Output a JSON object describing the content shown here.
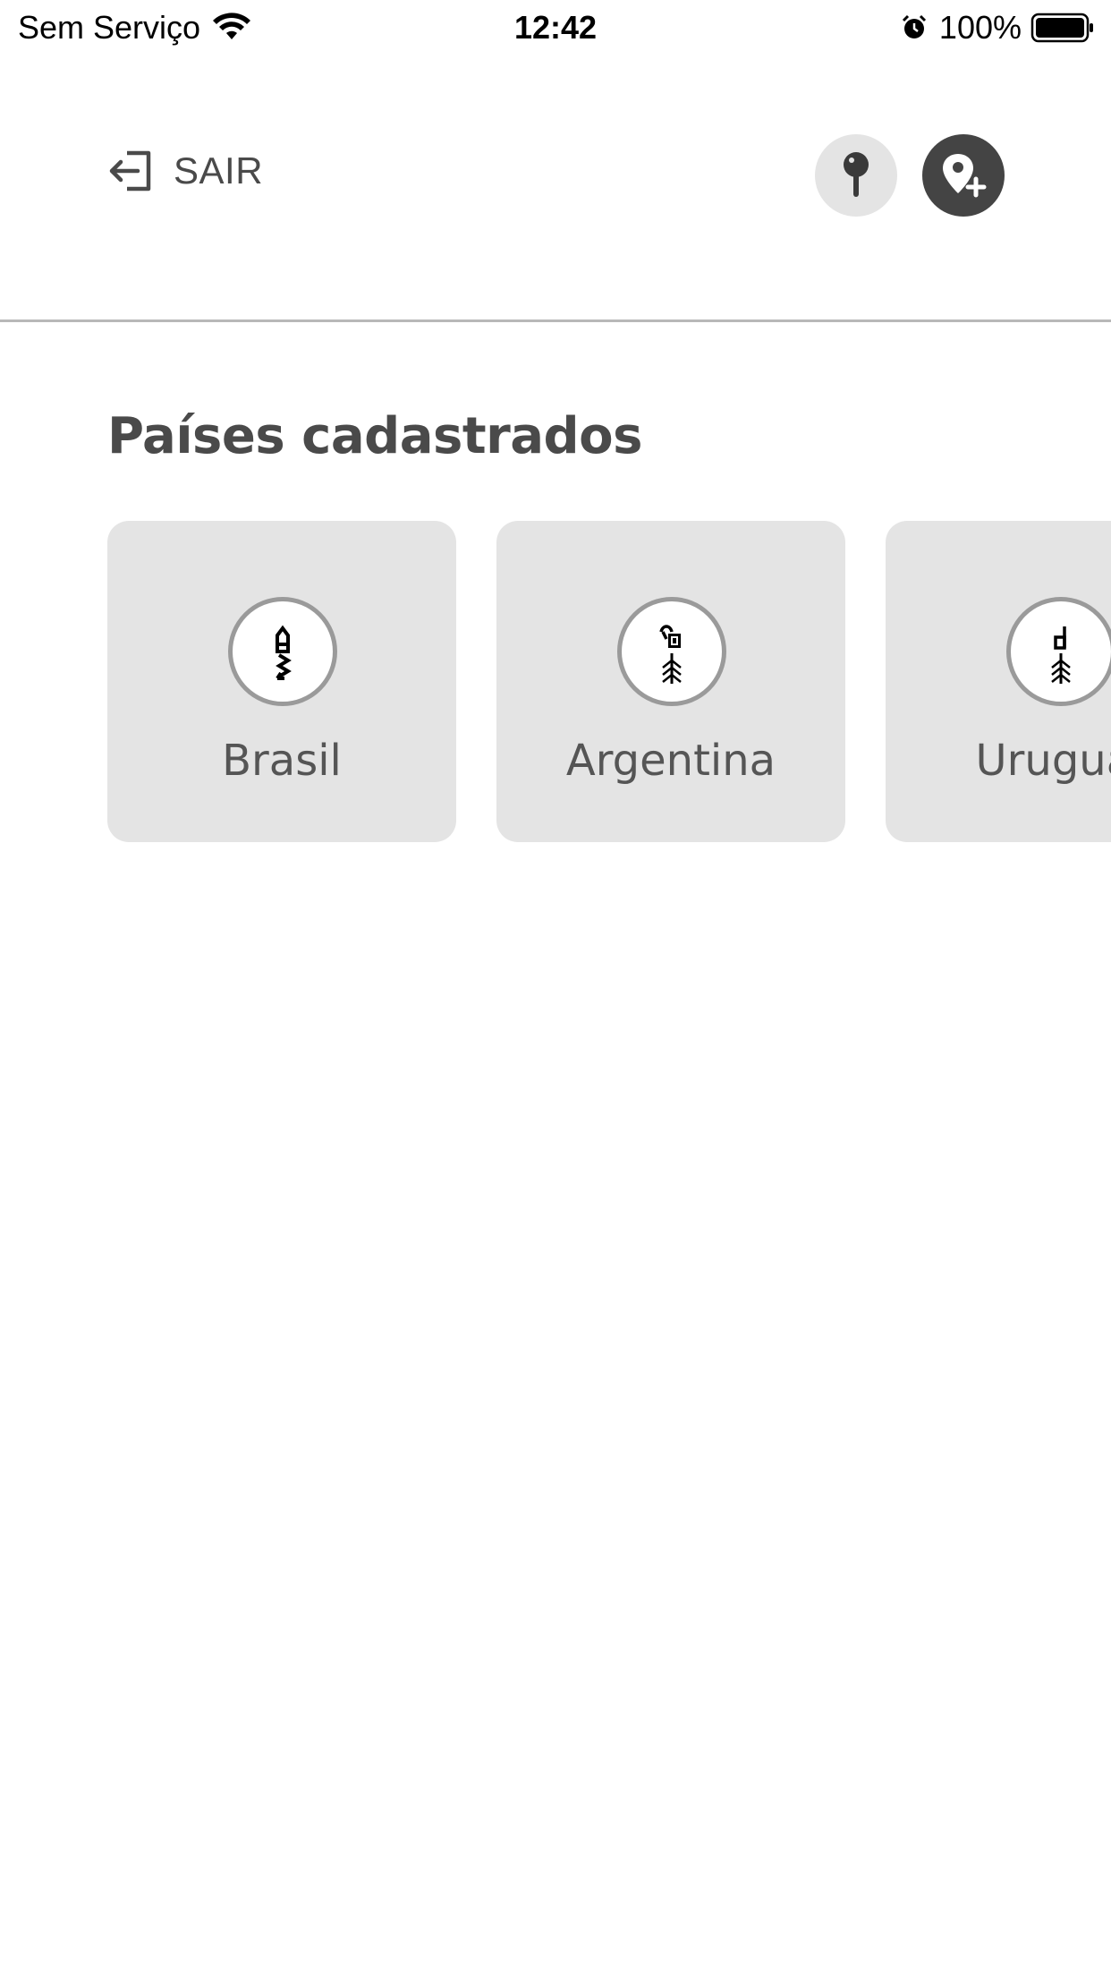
{
  "status_bar": {
    "carrier": "Sem Serviço",
    "time": "12:42",
    "battery": "100%"
  },
  "header": {
    "exit_label": "SAIR",
    "icons": [
      "exit-icon",
      "map-pin-icon",
      "map-pin-add-icon"
    ]
  },
  "section": {
    "title": "Países cadastrados"
  },
  "countries": [
    {
      "name": "Brasil",
      "icon": "brasil-glyph-icon"
    },
    {
      "name": "Argentina",
      "icon": "argentina-glyph-icon"
    },
    {
      "name": "Uruguai",
      "icon": "uruguai-glyph-icon"
    }
  ],
  "colors": {
    "card_background": "#e4e4e4",
    "dark_button": "#444444",
    "text": "#4a4a4a",
    "divider": "#b8b8b8"
  }
}
